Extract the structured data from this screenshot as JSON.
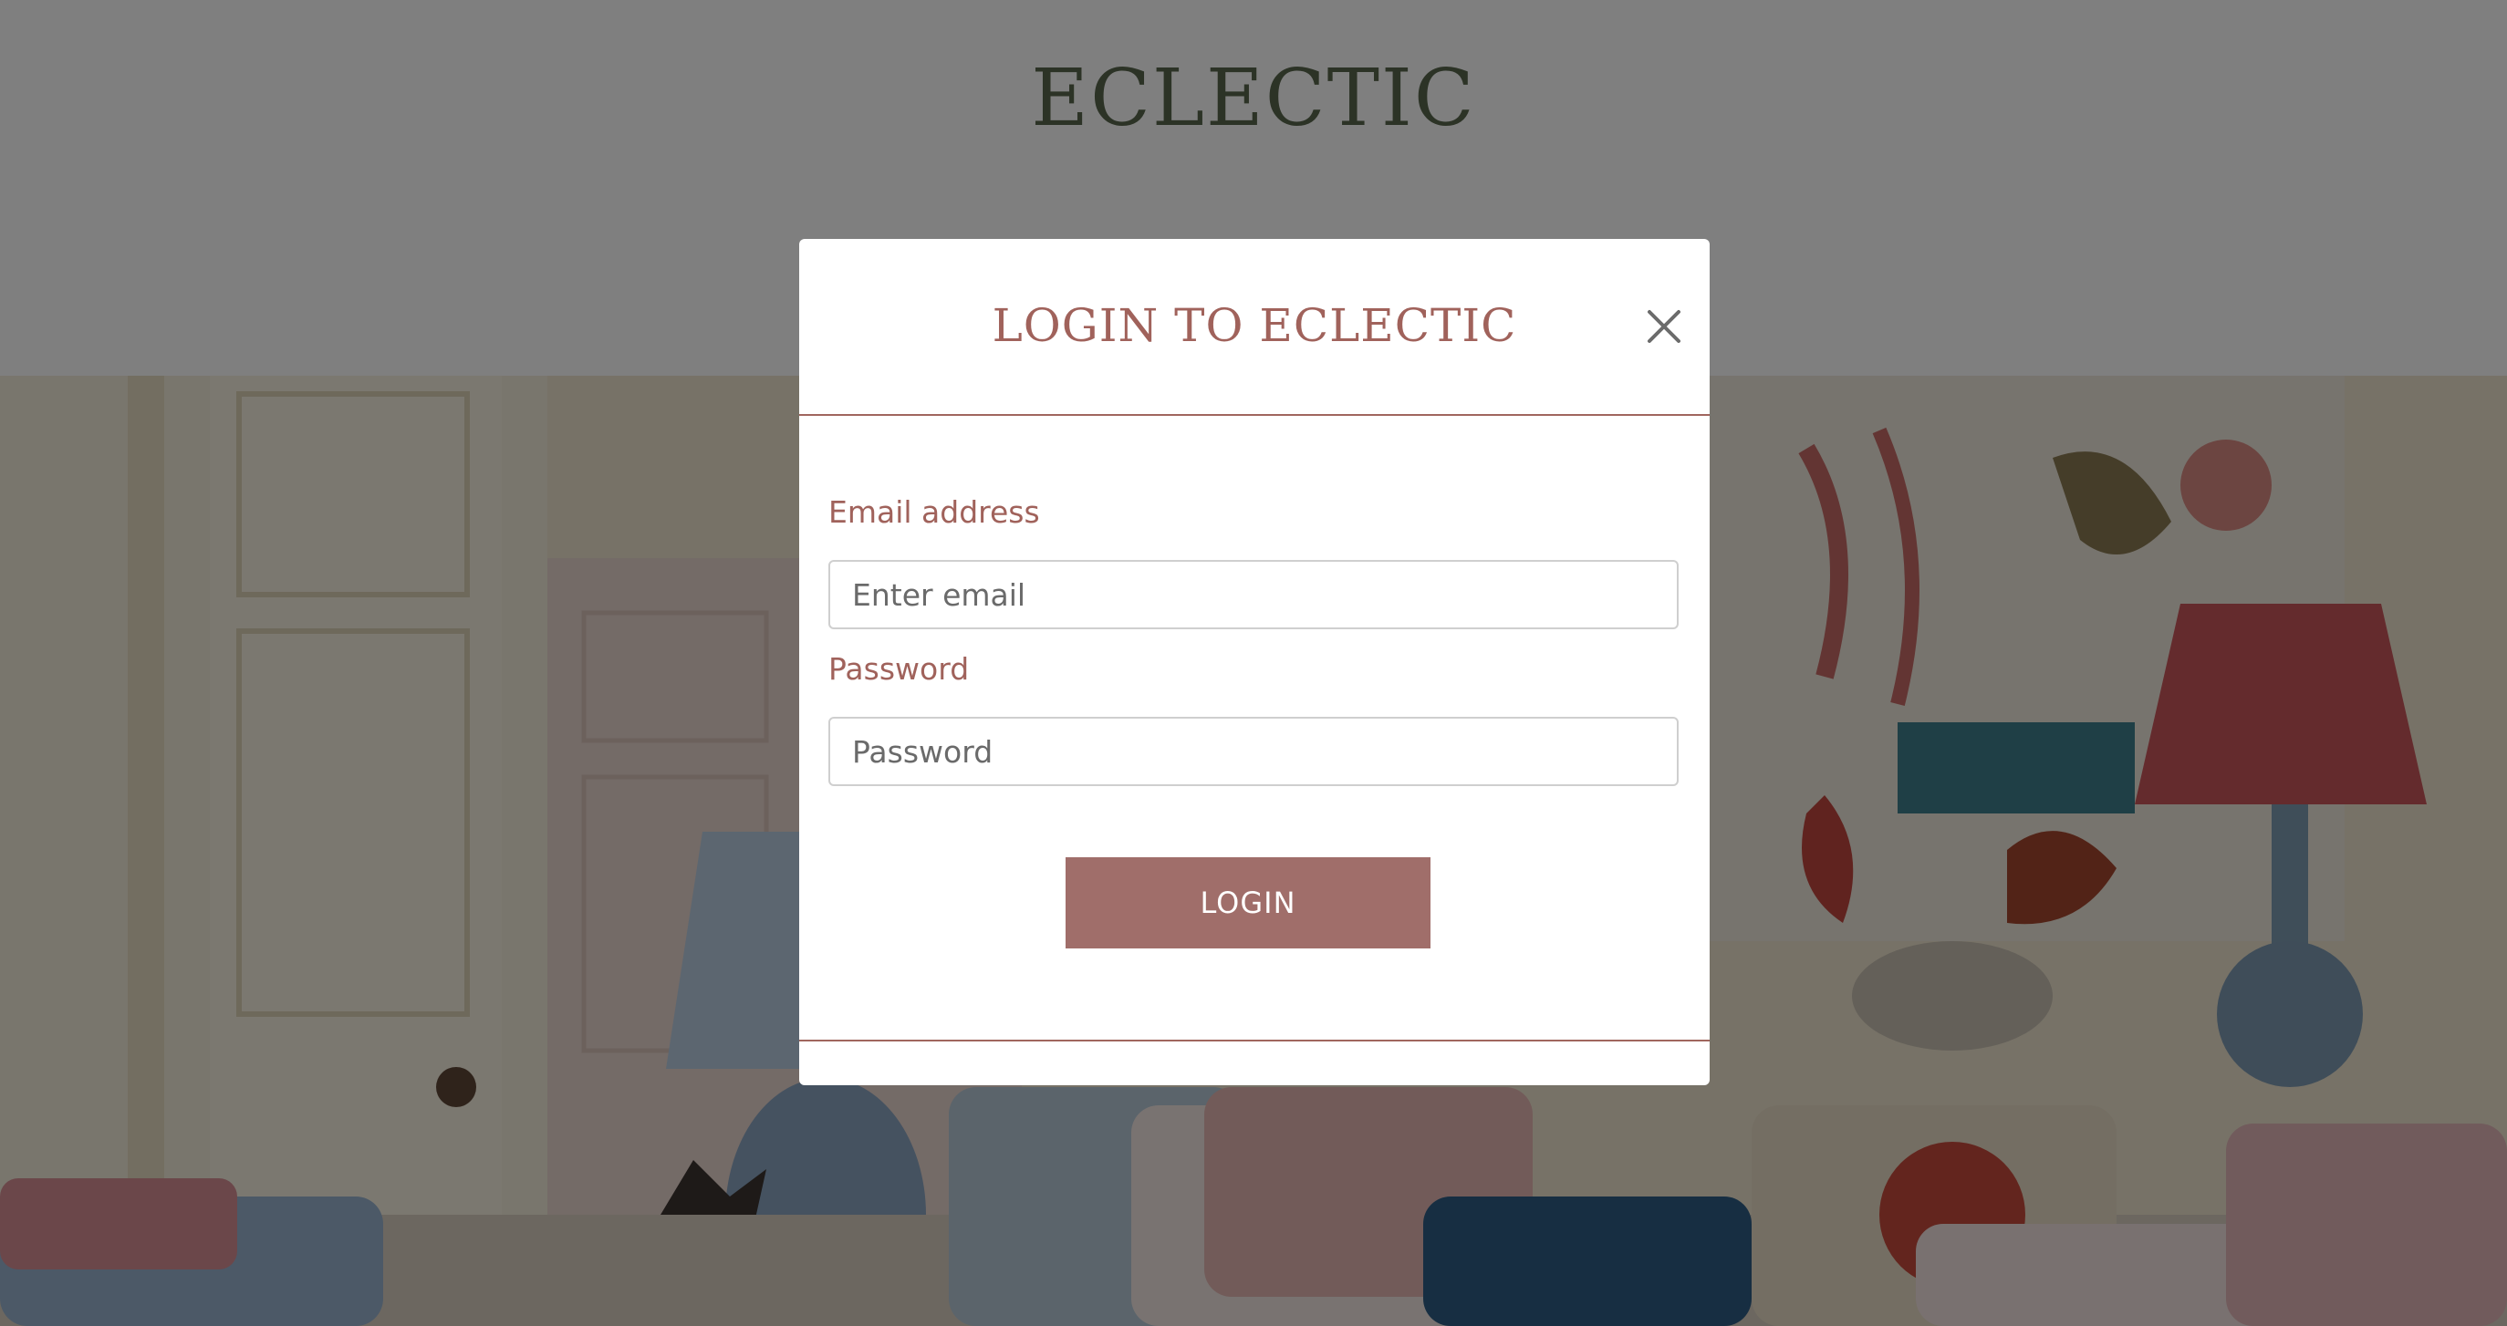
{
  "site": {
    "brand": "ECLECTIC"
  },
  "modal": {
    "title": "LOGIN TO ECLECTIC",
    "close_icon": "close-icon",
    "email": {
      "label": "Email address",
      "placeholder": "Enter email",
      "value": ""
    },
    "password": {
      "label": "Password",
      "placeholder": "Password",
      "value": ""
    },
    "login_label": "LOGIN"
  },
  "colors": {
    "brand_green": "#58664c",
    "accent_rose": "#a0625b",
    "button_rose": "#a06e6a",
    "overlay": "rgba(0,0,0,0.5)"
  }
}
